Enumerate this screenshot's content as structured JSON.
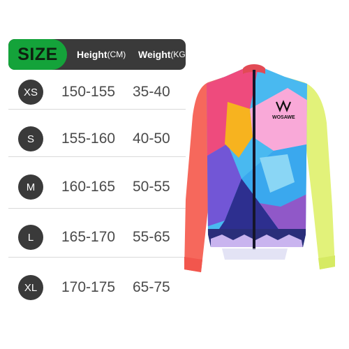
{
  "header": {
    "size_label": "SIZE",
    "height_label": "Height",
    "height_unit": "(CM)",
    "weight_label": "Weight",
    "weight_unit": "(KG)"
  },
  "rows": [
    {
      "size": "XS",
      "height": "150-155",
      "weight": "35-40"
    },
    {
      "size": "S",
      "height": "155-160",
      "weight": "40-50"
    },
    {
      "size": "M",
      "height": "160-165",
      "weight": "50-55"
    },
    {
      "size": "L",
      "height": "165-170",
      "weight": "55-65"
    },
    {
      "size": "XL",
      "height": "170-175",
      "weight": "65-75"
    }
  ],
  "jersey": {
    "brand": "WOSAWE"
  },
  "colors": {
    "header_bg": "#3a3a3a",
    "size_accent": "#14a33a",
    "text": "#4a4a4a"
  }
}
